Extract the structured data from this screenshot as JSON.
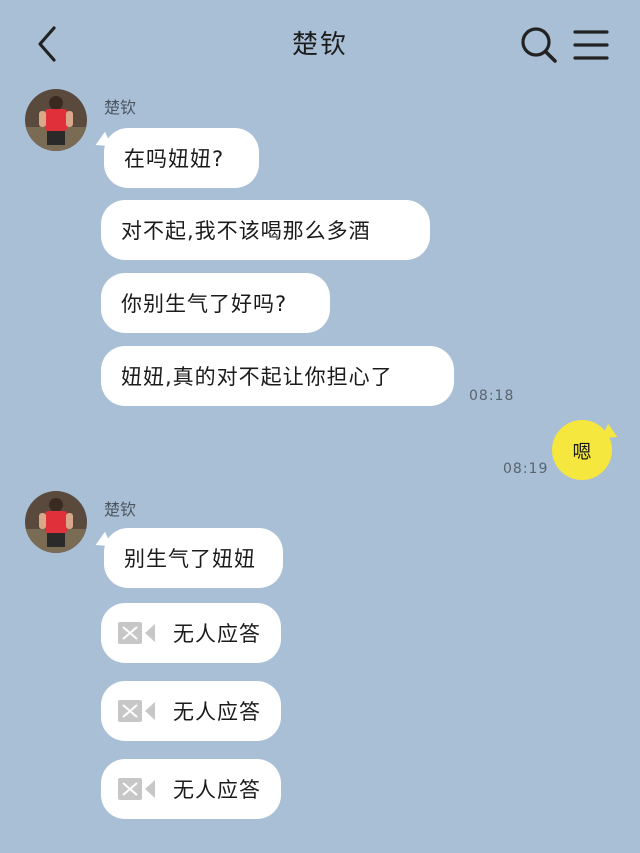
{
  "header": {
    "title": "楚钦"
  },
  "contact": {
    "name": "楚钦"
  },
  "messages_group1": [
    "在吗妞妞?",
    "对不起,我不该喝那么多酒",
    "你别生气了好吗?",
    "妞妞,真的对不起让你担心了"
  ],
  "time1": "08:18",
  "my_message": "嗯",
  "time2": "08:19",
  "messages_group2": {
    "text": "别生气了妞妞"
  },
  "calls": [
    {
      "label": "无人应答"
    },
    {
      "label": "无人应答"
    },
    {
      "label": "无人应答"
    }
  ],
  "icons": [
    "back-arrow-icon",
    "search-icon",
    "menu-icon",
    "video-camera-icon"
  ],
  "colors": {
    "background": "#a9bfd5",
    "my_bubble": "#f5e73d",
    "other_bubble": "#ffffff",
    "avatar_shirt": "#e0303a"
  }
}
